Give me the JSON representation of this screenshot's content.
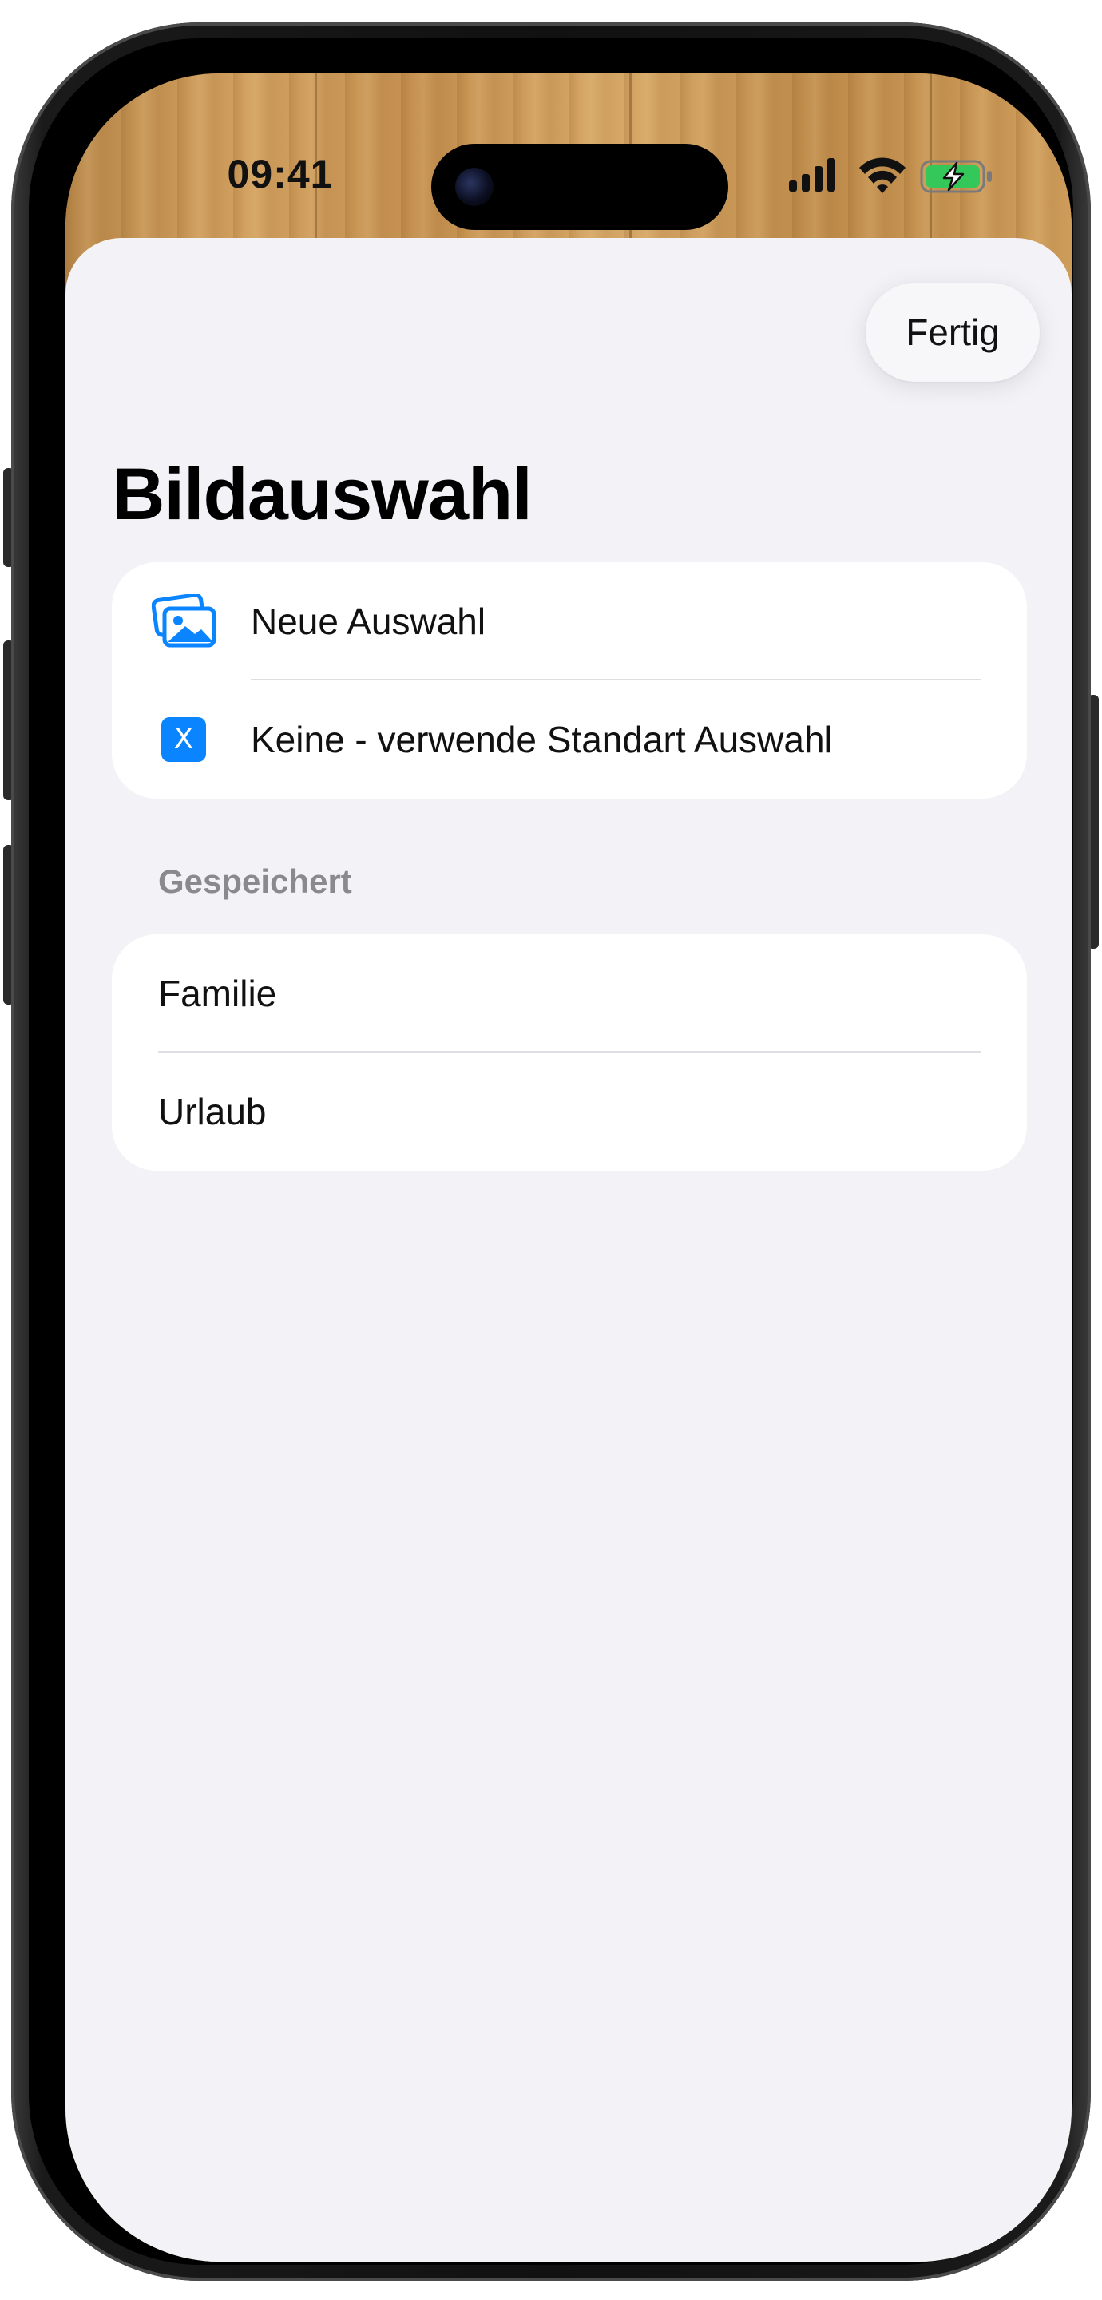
{
  "status_bar": {
    "time": "09:41",
    "icons": [
      "cellular-signal-icon",
      "wifi-icon",
      "battery-charging-icon"
    ],
    "battery_color": "#34c759"
  },
  "sheet": {
    "done_button_label": "Fertig",
    "title": "Bildauswahl",
    "options": [
      {
        "label": "Neue Auswahl",
        "icon": "photos-icon"
      },
      {
        "label": "Keine - verwende Standart Auswahl",
        "icon": "x-square-icon"
      }
    ],
    "saved_section": {
      "header": "Gespeichert",
      "items": [
        {
          "label": "Familie"
        },
        {
          "label": "Urlaub"
        }
      ]
    }
  },
  "colors": {
    "accent": "#0a84ff",
    "sheet_background": "#f2f2f7",
    "group_background": "#ffffff",
    "secondary_text": "#8a8a8e"
  }
}
